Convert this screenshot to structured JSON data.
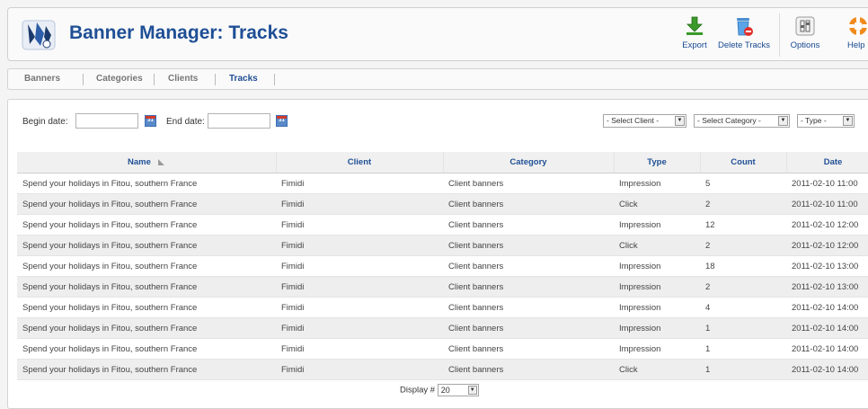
{
  "header": {
    "title": "Banner Manager: Tracks",
    "toolbar": [
      {
        "label": "Export",
        "icon": "export-icon"
      },
      {
        "label": "Delete Tracks",
        "icon": "delete-tracks-icon"
      },
      {
        "label": "Options",
        "icon": "options-icon"
      },
      {
        "label": "Help",
        "icon": "help-icon"
      }
    ]
  },
  "submenu": {
    "items": [
      "Banners",
      "Categories",
      "Clients",
      "Tracks"
    ],
    "active": "Tracks"
  },
  "filters": {
    "begin_label": "Begin date:",
    "begin_value": "",
    "end_label": "End date:",
    "end_value": "",
    "calendar_text": "31",
    "select_client": "- Select Client -",
    "select_category": "- Select Category -",
    "select_type": "- Type -"
  },
  "table": {
    "columns": [
      "Name",
      "Client",
      "Category",
      "Type",
      "Count",
      "Date"
    ],
    "rows": [
      [
        "Spend your holidays in Fitou, southern France",
        "Fimidi",
        "Client banners",
        "Impression",
        "5",
        "2011-02-10 11:00"
      ],
      [
        "Spend your holidays in Fitou, southern France",
        "Fimidi",
        "Client banners",
        "Click",
        "2",
        "2011-02-10 11:00"
      ],
      [
        "Spend your holidays in Fitou, southern France",
        "Fimidi",
        "Client banners",
        "Impression",
        "12",
        "2011-02-10 12:00"
      ],
      [
        "Spend your holidays in Fitou, southern France",
        "Fimidi",
        "Client banners",
        "Click",
        "2",
        "2011-02-10 12:00"
      ],
      [
        "Spend your holidays in Fitou, southern France",
        "Fimidi",
        "Client banners",
        "Impression",
        "18",
        "2011-02-10 13:00"
      ],
      [
        "Spend your holidays in Fitou, southern France",
        "Fimidi",
        "Client banners",
        "Impression",
        "2",
        "2011-02-10 13:00"
      ],
      [
        "Spend your holidays in Fitou, southern France",
        "Fimidi",
        "Client banners",
        "Impression",
        "4",
        "2011-02-10 14:00"
      ],
      [
        "Spend your holidays in Fitou, southern France",
        "Fimidi",
        "Client banners",
        "Impression",
        "1",
        "2011-02-10 14:00"
      ],
      [
        "Spend your holidays in Fitou, southern France",
        "Fimidi",
        "Client banners",
        "Impression",
        "1",
        "2011-02-10 14:00"
      ],
      [
        "Spend your holidays in Fitou, southern France",
        "Fimidi",
        "Client banners",
        "Click",
        "1",
        "2011-02-10 14:00"
      ]
    ]
  },
  "footer": {
    "display_label": "Display #",
    "display_value": "20"
  },
  "colors": {
    "title": "#1f4f95",
    "row_alt": "#eeeeee",
    "header_bg": "#f0f0f0"
  }
}
